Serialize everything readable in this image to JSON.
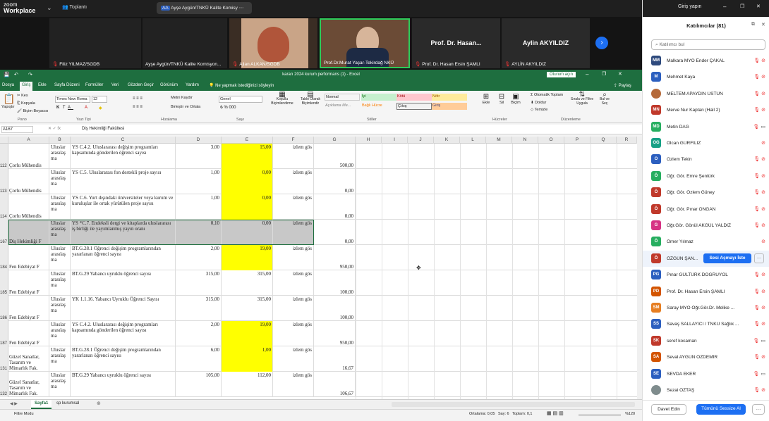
{
  "zoom": {
    "logo_top": "zoom",
    "logo_bottom": "Workplace",
    "meeting_label": "Toplantı",
    "share_label": "Ayşe Aygün/TNKÜ Kalite Komisy",
    "share_initials": "AA",
    "signin": "Giriş yapın"
  },
  "videos": [
    {
      "name": "Filiz YILMAZ/SGDB",
      "big": ""
    },
    {
      "name": "Ayşe Aygün/TNKÜ Kalite Komisyon...",
      "big": ""
    },
    {
      "name": "Ajlan ALKAN/SGDB",
      "big": ""
    },
    {
      "name": "Prof.Dr.Murat Yaşar-Tekirdağ NKÜ",
      "big": ""
    },
    {
      "name": "Prof. Dr. Hasan Ersin ŞAMLI",
      "big": "Prof. Dr. Hasan..."
    },
    {
      "name": "AYLİN AKYILDIZ",
      "big": "Aylin AKYILDIZ"
    }
  ],
  "excel": {
    "title": "kararı 2024 kurum performans (1) - Excel",
    "signin": "Oturum açın",
    "menu": [
      "Dosya",
      "Giriş",
      "Ekle",
      "Sayfa Düzeni",
      "Formüller",
      "Veri",
      "Gözden Geçir",
      "Görünüm",
      "Yardım",
      "Ne yapmak istediğinizi söyleyin"
    ],
    "share": "Paylaş",
    "font_name": "Times New Roma",
    "font_size": "12",
    "number_format": "Genel",
    "ribbon_labels": {
      "paste": "Yapıştır",
      "cut": "Kes",
      "copy": "Kopyala",
      "format_painter": "Biçim Boyacısı",
      "wrap": "Metni Kaydır",
      "merge": "Birleştir ve Ortala",
      "cond": "Koşullu Biçimlendirme",
      "table": "Tablo Olarak Biçimlendir",
      "insert": "Ekle",
      "delete": "Sil",
      "format": "Biçim",
      "autosum": "Otomatik Toplam",
      "fill": "Doldur",
      "clear": "Temizle",
      "sort": "Sırala ve Filtre Uygula",
      "find": "Bul ve Seç"
    },
    "styles": [
      {
        "label": "Normal",
        "bg": "#ffffff",
        "fg": "#222222"
      },
      {
        "label": "İyi",
        "bg": "#c6efce",
        "fg": "#006100"
      },
      {
        "label": "Kötü",
        "bg": "#ffc7ce",
        "fg": "#9c0006"
      },
      {
        "label": "Nötr",
        "bg": "#ffeb9c",
        "fg": "#9c5700"
      },
      {
        "label": "Açıklama Me...",
        "bg": "#ffffff",
        "fg": "#7f7f7f"
      },
      {
        "label": "Bağlı Hücre",
        "bg": "#ffffff",
        "fg": "#fa7d00"
      },
      {
        "label": "Çıkış",
        "bg": "#f2f2f2",
        "fg": "#3f3f3f"
      },
      {
        "label": "Giriş",
        "bg": "#ffcc99",
        "fg": "#3f3f76"
      }
    ],
    "groups": [
      "Pano",
      "Yazı Tipi",
      "Hizalama",
      "Sayı",
      "Stiller",
      "Hücreler",
      "Düzenleme"
    ],
    "cell_ref": "A167",
    "formula": "Diş Hekimliği Fakültesi",
    "columns": [
      "A",
      "B",
      "C",
      "D",
      "E",
      "F",
      "G",
      "H",
      "I",
      "J",
      "K",
      "L",
      "M",
      "N",
      "O",
      "P",
      "Q",
      "R"
    ],
    "rows": [
      {
        "num": "112",
        "a": "Çorlu Mühendis",
        "b": "Uluslar arasılaş ma",
        "c": "YS C.4.2. Uluslararası değişim programları kapsamında gönderilen öğrenci sayısı",
        "d": "3,00",
        "e": "15,00",
        "f": "izlem gös",
        "g": "500,00",
        "style": "yel"
      },
      {
        "num": "113",
        "a": "Çorlu Mühendis",
        "b": "Uluslar arasılaş ma",
        "c": "YS C.5. Uluslararası fon destekli proje sayısı",
        "d": "1,00",
        "e": "0,00",
        "f": "izlem gös",
        "g": "0,00",
        "style": "yel"
      },
      {
        "num": "114",
        "a": "Çorlu Mühendis",
        "b": "Uluslar arasılaş ma",
        "c": "YS C.6. Yurt dışındaki üniversiteler veya kurum ve kuruluşlar ile ortak yürütülen proje sayısı",
        "d": "1,00",
        "e": "0,00",
        "f": "izlem gös",
        "g": "0,00",
        "style": "yel"
      },
      {
        "num": "167",
        "a": "Diş Hekimliği F",
        "b": "Uluslar arasılaş ma",
        "c": "YS *C.7. Endeksli dergi ve kitaplarda uluslararası iş birliği ile yayımlanmış yayın oranı",
        "d": "0,10",
        "e": "0,00",
        "f": "izlem gös",
        "g": "0,00",
        "style": "gry"
      },
      {
        "num": "184",
        "a": "Fen Edebiyat F",
        "b": "Uluslar arasılaş ma",
        "c": "BT.G.28.1 Öğrenci değişim programlarından yararlanan öğrenci sayısı",
        "d": "2,00",
        "e": "19,00",
        "f": "izlem gös",
        "g": "950,00",
        "style": "yel"
      },
      {
        "num": "185",
        "a": "Fen Edebiyat F",
        "b": "Uluslar arasılaş ma",
        "c": "BT.G.29 Yabancı uyruklu öğrenci sayısı",
        "d": "315,00",
        "e": "315,00",
        "f": "izlem gös",
        "g": "100,00",
        "style": ""
      },
      {
        "num": "186",
        "a": "Fen Edebiyat F",
        "b": "Uluslar arasılaş ma",
        "c": "YK 1.1.16. Yabancı Uyruklu Öğrenci Sayısı",
        "d": "315,00",
        "e": "315,00",
        "f": "izlem gös",
        "g": "100,00",
        "style": ""
      },
      {
        "num": "187",
        "a": "Fen Edebiyat F",
        "b": "Uluslar arasılaş ma",
        "c": "YS C.4.2. Uluslararası değişim programları kapsamında gönderilen öğrenci sayısı",
        "d": "2,00",
        "e": "19,00",
        "f": "izlem gös",
        "g": "950,00",
        "style": "yel"
      },
      {
        "num": "131",
        "a": "Güzel Sanatlar, Tasarım ve Mimarlık Fak.",
        "b": "Uluslar arasılaş ma",
        "c": "BT.G.28.1 Öğrenci değişim programlarından yararlanan öğrenci sayısı",
        "d": "6,00",
        "e": "1,00",
        "f": "izlem gös",
        "g": "16,67",
        "style": "yel"
      },
      {
        "num": "132",
        "a": "Güzel Sanatlar, Tasarım ve Mimarlık Fak.",
        "b": "Uluslar arasılaş ma",
        "c": "BT.G.29 Yabancı uyruklu öğrenci sayısı",
        "d": "105,00",
        "e": "112,00",
        "f": "izlem gös",
        "g": "106,67",
        "style": ""
      }
    ],
    "sheets": [
      "Sayfa1",
      "sp kurumsal"
    ],
    "status_left": "Filtre Modu",
    "status_stats": "Ortalama: 0,05   Say: 6   Toplam: 0,1",
    "zoom_level": "%120"
  },
  "participants": {
    "title": "Katılımcılar (81)",
    "search_placeholder": "Katılımcı bul",
    "list": [
      {
        "name": "Malkara MYO Ender ÇAKAL",
        "initials": "MM",
        "color": "#2e4a7d",
        "icons": "mutevid"
      },
      {
        "name": "Mehmet Kaya",
        "initials": "M",
        "color": "#2c5fbf",
        "icons": "mutevid"
      },
      {
        "name": "MELTEM APAYDIN ÜSTÜN",
        "initials": "",
        "color": "#b56a3a",
        "icons": "mutevid"
      },
      {
        "name": "Merve Nur Kaptan (Hall 2)",
        "initials": "MN",
        "color": "#c0392b",
        "icons": "mutevid"
      },
      {
        "name": "Metin DAĞ",
        "initials": "MD",
        "color": "#27ae60",
        "icons": "cam"
      },
      {
        "name": "Olcan GÜRFİLİZ",
        "initials": "OG",
        "color": "#16a085",
        "icons": "vid"
      },
      {
        "name": "Ozlem Tekin",
        "initials": "O",
        "color": "#2c5fbf",
        "icons": "mutevid"
      },
      {
        "name": "Öğr. Gör. Emre Şentürk",
        "initials": "Ö",
        "color": "#27ae60",
        "icons": "mutevid"
      },
      {
        "name": "Öğr. Gör. Özlem Güney",
        "initials": "Ö",
        "color": "#c0392b",
        "icons": "mutevid"
      },
      {
        "name": "Öğr. Gör. Pınar ONGAN",
        "initials": "Ö",
        "color": "#c0392b",
        "icons": "mutevid"
      },
      {
        "name": "Öğr.Gör. Gönül AKGÜL YALDIZ",
        "initials": "G",
        "color": "#d63384",
        "icons": "mutevid"
      },
      {
        "name": "Ömer Yılmaz",
        "initials": "Ö",
        "color": "#27ae60",
        "icons": "vid"
      },
      {
        "name": "ÖZGÜN ŞAN...",
        "initials": "Ö",
        "color": "#c0392b",
        "icons": "ask"
      },
      {
        "name": "Pınar GÜLTÜRK DOĞRUYOL",
        "initials": "PG",
        "color": "#2c5fbf",
        "icons": "mutevid"
      },
      {
        "name": "Prof. Dr. Hasan Ersin ŞAMLI",
        "initials": "PD",
        "color": "#d35400",
        "icons": "mutevid"
      },
      {
        "name": "Saray MYO Öğr.Gör.Dr. Melike ...",
        "initials": "SM",
        "color": "#e67e22",
        "icons": "mutevid"
      },
      {
        "name": "Savaş SALLAYICI / TNKÜ Sağlık ...",
        "initials": "SS",
        "color": "#2c5fbf",
        "icons": "mutevid"
      },
      {
        "name": "seref kocaman",
        "initials": "SK",
        "color": "#c0392b",
        "icons": "cam"
      },
      {
        "name": "Seval AYGÜN ÖZDEMİR",
        "initials": "SA",
        "color": "#d35400",
        "icons": "mutevid"
      },
      {
        "name": "SEVDA EKER",
        "initials": "SE",
        "color": "#2c5fbf",
        "icons": "cam"
      },
      {
        "name": "Sezai ÖZTAŞ",
        "initials": "",
        "color": "#7f8c8d",
        "icons": "mutevid"
      }
    ],
    "ask_unmute": "Sesi Açmayı İste",
    "invite": "Davet Edin",
    "mute_all": "Tümünü Sessize Al",
    "more": "···"
  }
}
